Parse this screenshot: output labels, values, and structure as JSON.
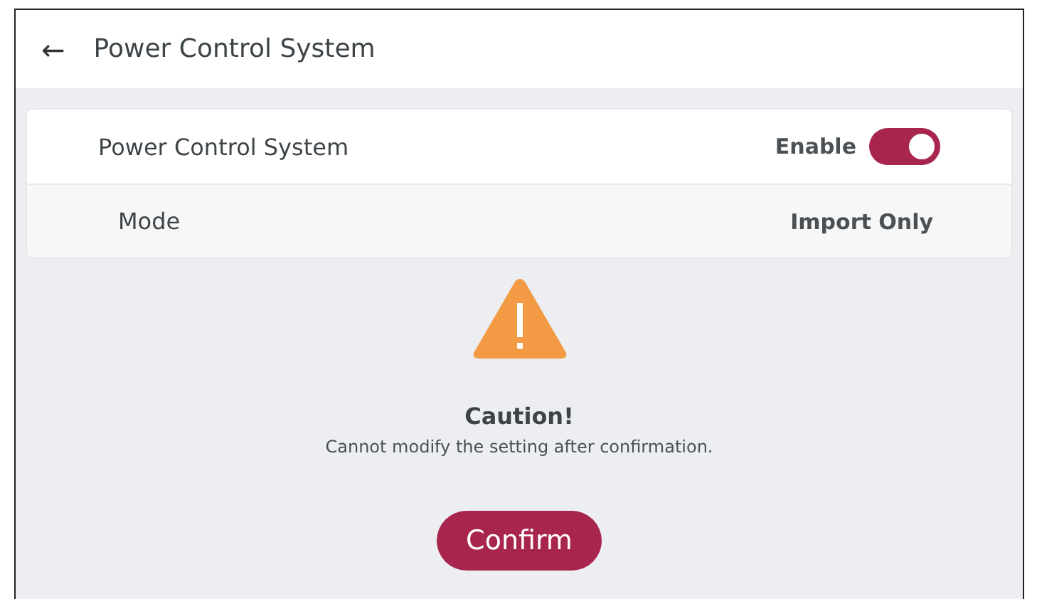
{
  "header": {
    "back": "←",
    "title": "Power Control System"
  },
  "settings": [
    {
      "kind": "toggle",
      "label": "Power Control System",
      "value": "Enable",
      "on": true
    },
    {
      "kind": "value",
      "label": "Mode",
      "value": "Import Only"
    }
  ],
  "caution": {
    "title": "Caution!",
    "message": "Cannot modify the setting after confirmation."
  },
  "confirm_button": "Confirm"
}
